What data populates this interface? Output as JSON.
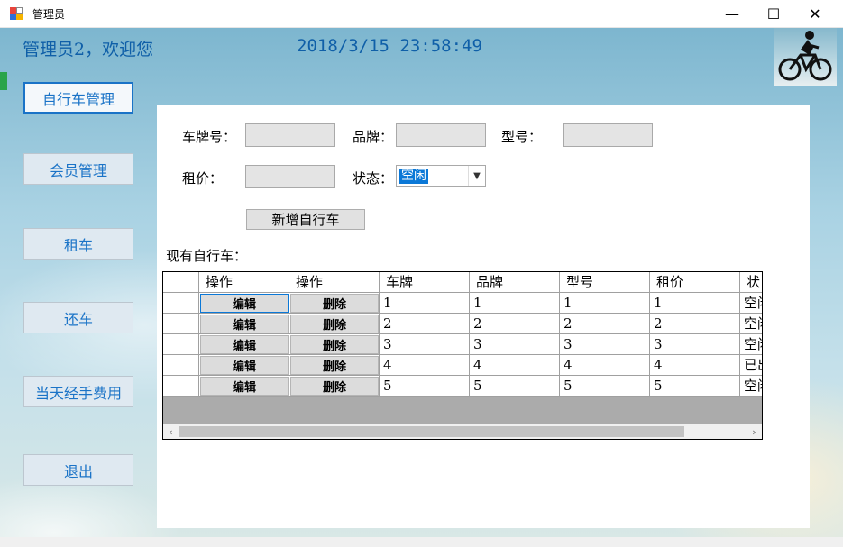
{
  "window": {
    "title": "管理员",
    "min": "—",
    "max": "☐",
    "close": "✕"
  },
  "header": {
    "greeting": "管理员2，欢迎您",
    "datetime": "2018/3/15  23:58:49",
    "logo_icon": "cyclist-icon"
  },
  "nav": {
    "bike_manage": "自行车管理",
    "member_manage": "会员管理",
    "rent": "租车",
    "return": "还车",
    "daily_fees": "当天经手费用",
    "exit": "退出"
  },
  "form": {
    "plate_label": "车牌号：",
    "brand_label": "品牌：",
    "model_label": "型号：",
    "price_label": "租价：",
    "status_label": "状态：",
    "status_value": "空闲",
    "add_button": "新增自行车"
  },
  "grid": {
    "title": "现有自行车：",
    "headers": [
      "操作",
      "操作",
      "车牌",
      "品牌",
      "型号",
      "租价",
      "状"
    ],
    "edit_label": "编辑",
    "delete_label": "删除",
    "rows": [
      {
        "plate": "1",
        "brand": "1",
        "model": "1",
        "price": "1",
        "status": "空闲"
      },
      {
        "plate": "2",
        "brand": "2",
        "model": "2",
        "price": "2",
        "status": "空闲"
      },
      {
        "plate": "3",
        "brand": "3",
        "model": "3",
        "price": "3",
        "status": "空闲"
      },
      {
        "plate": "4",
        "brand": "4",
        "model": "4",
        "price": "4",
        "status": "已出"
      },
      {
        "plate": "5",
        "brand": "5",
        "model": "5",
        "price": "5",
        "status": "空闲"
      }
    ]
  },
  "colors": {
    "accent": "#1a73c7",
    "title_text": "#0f5fa8",
    "selection": "#0b78d7"
  }
}
